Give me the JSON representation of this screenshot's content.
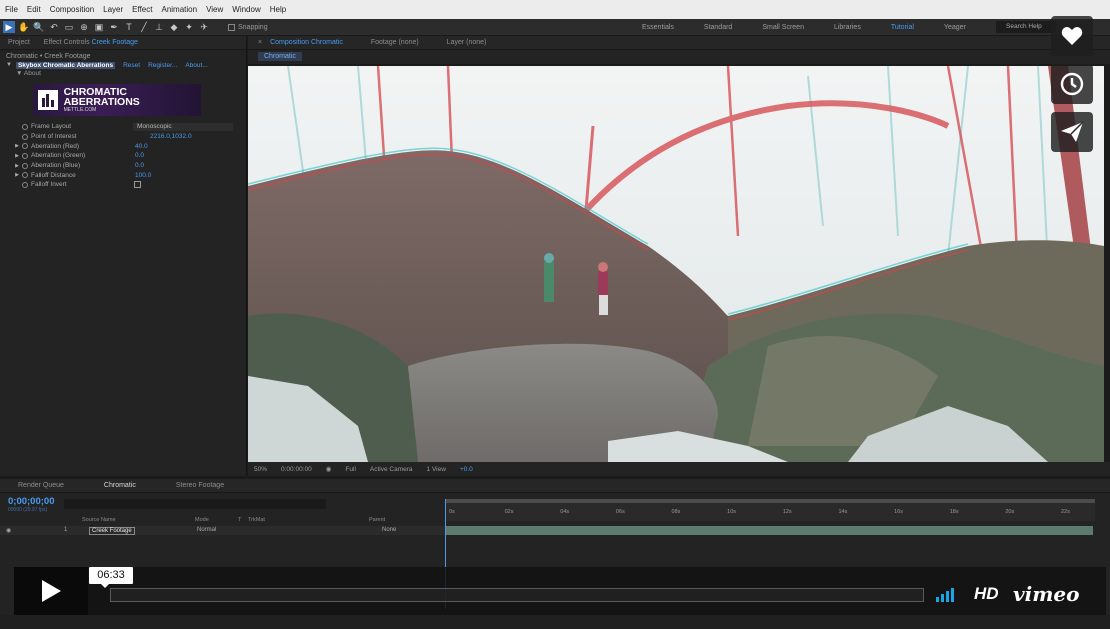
{
  "menu": [
    "File",
    "Edit",
    "Composition",
    "Layer",
    "Effect",
    "Animation",
    "View",
    "Window",
    "Help"
  ],
  "toolbar": {
    "tools": [
      "▶",
      "✋",
      "🔍",
      "↶",
      "▭",
      "⊕",
      "▣",
      "✒",
      "T",
      "╱",
      "⊥",
      "◆",
      "✦",
      "✈"
    ],
    "snapping": "Snapping",
    "workspaces": [
      "Essentials",
      "Standard",
      "Small Screen",
      "Libraries",
      "Tutorial",
      "Yeager"
    ],
    "active_workspace": "Tutorial",
    "search_help": "Search Help"
  },
  "left_panel": {
    "tabs": [
      "Project",
      "Effect Controls",
      "Creek Footage"
    ],
    "path": "Chromatic • Creek Footage",
    "effect_name": "Skybox Chromatic Aberrations",
    "effect_links": [
      "Reset",
      "Register...",
      "About..."
    ],
    "about": "About",
    "logo_title": "CHROMATIC ABERRATIONS",
    "logo_sub": "METTLE.COM",
    "properties": [
      {
        "label": "Frame Layout",
        "value": "Monoscopic",
        "kind": "dropdown",
        "twirl": ""
      },
      {
        "label": "Point of Interest",
        "value": "2216.0,1032.0",
        "kind": "point",
        "twirl": ""
      },
      {
        "label": "Aberration (Red)",
        "value": "40.0",
        "kind": "value",
        "twirl": "▶"
      },
      {
        "label": "Aberration (Green)",
        "value": "0.0",
        "kind": "value",
        "twirl": "▶"
      },
      {
        "label": "Aberration (Blue)",
        "value": "0.0",
        "kind": "value",
        "twirl": "▶"
      },
      {
        "label": "Falloff Distance",
        "value": "100.0",
        "kind": "value",
        "twirl": "▶"
      },
      {
        "label": "Falloff Invert",
        "value": "",
        "kind": "checkbox",
        "twirl": ""
      }
    ]
  },
  "comp_panel": {
    "tabs": [
      "Composition Chromatic",
      "Footage (none)",
      "Layer (none)"
    ],
    "sub_tab": "Chromatic",
    "zoom": "50%",
    "timecode": "0:00:00:00",
    "resolution": "Full",
    "camera": "Active Camera",
    "views": "1 View",
    "exposure": "+0.0"
  },
  "timeline": {
    "tabs": [
      "Render Queue",
      "Chromatic",
      "Stereo Footage"
    ],
    "selected_tab": "Chromatic",
    "timecode": "0;00;00;00",
    "timecode_sub": "00000 (29.97 fps)",
    "columns": [
      "Source Name",
      "Mode",
      "T",
      "TrkMat",
      "Parent"
    ],
    "layer": {
      "index": "1",
      "name": "Creek Footage",
      "mode": "Normal",
      "parent": "None"
    },
    "ruler_ticks": [
      "0s",
      "02s",
      "04s",
      "06s",
      "08s",
      "10s",
      "12s",
      "14s",
      "16s",
      "18s",
      "20s",
      "22s"
    ]
  },
  "player": {
    "time": "06:33",
    "hd": "HD",
    "brand": "vimeo",
    "icons": [
      "heart-icon",
      "clock-icon",
      "send-icon",
      "play-icon"
    ]
  },
  "colors": {
    "accent": "#4a9bf0",
    "vimeo_blue": "#1aa6e6",
    "layer_bar": "#5d7a6e"
  }
}
